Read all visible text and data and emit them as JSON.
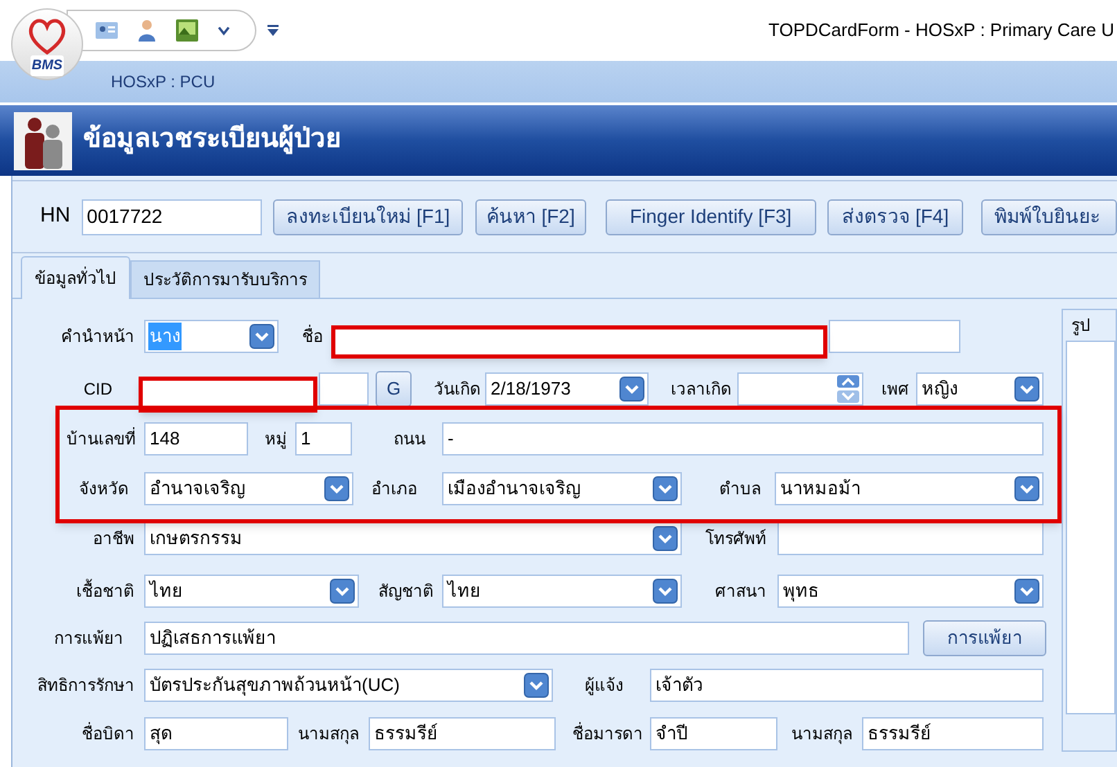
{
  "window": {
    "logo_text": "BMS",
    "title": "TOPDCardForm -  HOSxP : Primary Care U"
  },
  "ribbon": {
    "label": "HOSxP : PCU"
  },
  "header": {
    "title": "ข้อมูลเวชระเบียนผู้ป่วย"
  },
  "toolbar": {
    "hn_label": "HN",
    "hn_value": "0017722",
    "buttons": [
      "ลงทะเบียนใหม่ [F1]",
      "ค้นหา [F2]",
      "Finger Identify [F3]",
      "ส่งตรวจ [F4]",
      "พิมพ์ใบยินยะ"
    ]
  },
  "tabs": [
    {
      "label": "ข้อมูลทั่วไป",
      "selected": true
    },
    {
      "label": "ประวัติการมารับบริการ",
      "selected": false
    }
  ],
  "photo_panel": {
    "title": "รูป"
  },
  "form": {
    "lines": [
      {
        "items": [
          {
            "kind": "label",
            "text": "คำนำหน้า"
          },
          {
            "kind": "combo",
            "value": "นาง",
            "highlighted": true
          },
          {
            "kind": "label",
            "text": "ชื่อ"
          },
          {
            "kind": "field"
          }
        ]
      },
      {
        "items": [
          {
            "kind": "label",
            "text": "CID"
          },
          {
            "kind": "field"
          },
          {
            "kind": "button",
            "text": "G"
          },
          {
            "kind": "label",
            "text": "วันเกิด"
          },
          {
            "kind": "combo",
            "value": "2/18/1973",
            "highlighted": false
          },
          {
            "kind": "label",
            "text": "เวลาเกิด"
          },
          {
            "kind": "spin"
          },
          {
            "kind": "label",
            "text": "เพศ"
          },
          {
            "kind": "combo",
            "value": "หญิง",
            "highlighted": false
          }
        ]
      },
      {
        "items": [
          {
            "kind": "label",
            "text": "บ้านเลขที่"
          },
          {
            "kind": "field",
            "value": "148"
          },
          {
            "kind": "label",
            "text": "หมู่"
          },
          {
            "kind": "field",
            "value": "1"
          },
          {
            "kind": "label",
            "text": "ถนน"
          },
          {
            "kind": "field",
            "value": "-"
          }
        ]
      },
      {
        "items": [
          {
            "kind": "label",
            "text": "จังหวัด"
          },
          {
            "kind": "combo",
            "value": "อำนาจเจริญ",
            "highlighted": false
          },
          {
            "kind": "label",
            "text": "อำเภอ"
          },
          {
            "kind": "combo",
            "value": "เมืองอำนาจเจริญ",
            "highlighted": false
          },
          {
            "kind": "label",
            "text": "ตำบล"
          },
          {
            "kind": "combo",
            "value": "นาหมอม้า",
            "highlighted": false
          }
        ]
      },
      {
        "items": [
          {
            "kind": "label",
            "text": "อาชีพ"
          },
          {
            "kind": "combo",
            "value": "เกษตรกรรม",
            "highlighted": false
          },
          {
            "kind": "label",
            "text": "โทรศัพท์"
          },
          {
            "kind": "field"
          }
        ]
      },
      {
        "items": [
          {
            "kind": "label",
            "text": "เชื้อชาติ"
          },
          {
            "kind": "combo",
            "value": "ไทย",
            "highlighted": false
          },
          {
            "kind": "label",
            "text": "สัญชาติ"
          },
          {
            "kind": "combo",
            "value": "ไทย",
            "highlighted": false
          },
          {
            "kind": "label",
            "text": "ศาสนา"
          },
          {
            "kind": "combo",
            "value": "พุทธ",
            "highlighted": false
          }
        ]
      },
      {
        "items": [
          {
            "kind": "label",
            "text": "การแพ้ยา"
          },
          {
            "kind": "field",
            "value": "ปฏิเสธการแพ้ยา"
          },
          {
            "kind": "button",
            "text": "การแพ้ยา"
          }
        ]
      },
      {
        "items": [
          {
            "kind": "label",
            "text": "สิทธิการรักษา"
          },
          {
            "kind": "combo",
            "value": "บัตรประกันสุขภาพถ้วนหน้า(UC)",
            "highlighted": false
          },
          {
            "kind": "label",
            "text": "ผู้แจ้ง"
          },
          {
            "kind": "field",
            "value": "เจ้าตัว"
          }
        ]
      },
      {
        "items": [
          {
            "kind": "label",
            "text": "ชื่อบิดา"
          },
          {
            "kind": "field",
            "value": "สุด"
          },
          {
            "kind": "label",
            "text": "นามสกุล"
          },
          {
            "kind": "field",
            "value": "ธรรมรีย์"
          },
          {
            "kind": "label",
            "text": "ชื่อมารดา"
          },
          {
            "kind": "field",
            "value": "จำปี"
          },
          {
            "kind": "label",
            "text": "นามสกุล"
          },
          {
            "kind": "field",
            "value": "ธรรมรีย์"
          }
        ]
      }
    ]
  }
}
